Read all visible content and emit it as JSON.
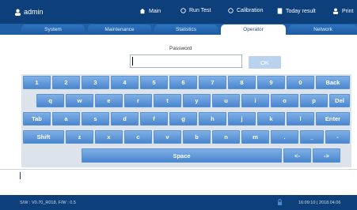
{
  "user": {
    "name": "admin",
    "icon": "user-icon"
  },
  "nav": [
    {
      "label": "Main",
      "icon": "home-icon"
    },
    {
      "label": "Run Test",
      "icon": "radio-icon"
    },
    {
      "label": "Calibration",
      "icon": "radio-icon"
    },
    {
      "label": "Today result",
      "icon": "document-icon"
    },
    {
      "label": "Print",
      "icon": "user-icon"
    }
  ],
  "tabs": [
    "System",
    "Maintenance",
    "Statistics",
    "Operator",
    "Network"
  ],
  "active_tab": "Operator",
  "password": {
    "label": "Password",
    "value": ""
  },
  "ok_label": "OK",
  "keys": [
    [
      "1",
      "2",
      "3",
      "4",
      "5",
      "6",
      "7",
      "8",
      "9",
      "0",
      "Back"
    ],
    [
      "q",
      "w",
      "e",
      "r",
      "t",
      "y",
      "u",
      "i",
      "o",
      "p",
      "Del"
    ],
    [
      "Tab",
      "a",
      "s",
      "d",
      "f",
      "g",
      "h",
      "j",
      "k",
      "l",
      "Enter"
    ],
    [
      "Shift",
      "z",
      "x",
      "c",
      "v",
      "b",
      "n",
      "m",
      ".",
      "_",
      "-"
    ],
    [
      "Space",
      "<-",
      "->"
    ]
  ],
  "message": "",
  "status": {
    "firmware": "S/W : V0.70_R018, F/W : 0.5",
    "lock_icon": "lock-icon",
    "datetime": "16:09:10 | 2018.04.06"
  },
  "colors": {
    "header": "#0d3f7a",
    "tab": "#1e5fa6",
    "key": "#5d92d2",
    "ok": "#b9d3ee"
  }
}
